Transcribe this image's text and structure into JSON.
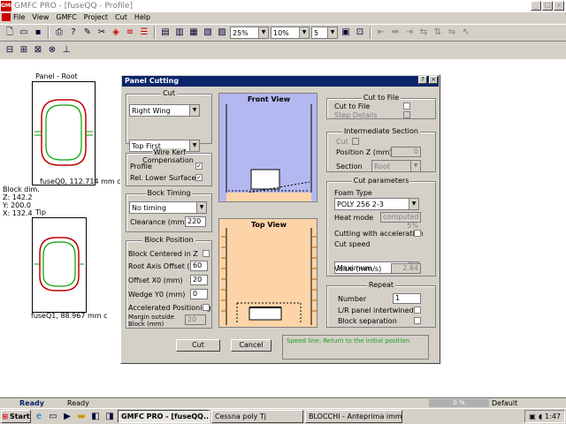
{
  "window": {
    "title": "GMFC PRO - [fuseQQ - Profile]",
    "icon": "gmfc-icon"
  },
  "menu": [
    "File",
    "View",
    "GMFC",
    "Project",
    "Cut",
    "Help"
  ],
  "toolbar": {
    "zoom1": "25%",
    "zoom2": "10%",
    "steps": "5"
  },
  "panels": {
    "root_label": "Panel - Root",
    "root_caption": "fuseQ0, 112.714 mm c",
    "tip_label": "Tip",
    "tip_caption": "fuseQ1, 88.967 mm c",
    "block_dim": [
      "Block dim.",
      "Z: 142.2",
      "Y: 200.0",
      "X: 132.4"
    ]
  },
  "dialog": {
    "title": "Panel Cutting",
    "cut": {
      "title": "Cut",
      "wing": "Right Wing",
      "order": "Top First"
    },
    "kerf": {
      "title": "Wire Kerf Compensation",
      "profile": "Profile",
      "lower": "Rel. Lower Surface"
    },
    "timing": {
      "title": "Bock Timing",
      "mode": "No timing",
      "clearance_label": "Clearance (mm)",
      "clearance": "220"
    },
    "block": {
      "title": "Block Position",
      "centered": "Block Centered in Z",
      "root_axis_label": "Root Axis Offset (mm)",
      "root_axis": "60",
      "offset_x0_label": "Offset X0 (mm)",
      "offset_x0": "20",
      "wedge_label": "Wedge Y0 (mm)",
      "wedge": "0",
      "accel": "Accelerated Positioning",
      "margin_label": "Margin outside Block (mm)",
      "margin": "20"
    },
    "front_view": "Front View",
    "top_view": "Top View",
    "cut_to_file": {
      "title": "Cut to File",
      "cut": "Cut to File",
      "step": "Step Details"
    },
    "intermediate": {
      "title": "Intermediate Section",
      "cut": "Cut",
      "position_label": "Position Z (mm)",
      "position": "0",
      "section_label": "Section",
      "section": "Root"
    },
    "params": {
      "title": "Cut parameters",
      "foam_label": "Foam Type",
      "foam": "POLY 256 2-3",
      "heat_label": "Heat mode",
      "heat": "computed 5%",
      "accel": "Cutting with acceleration",
      "speed_label": "Cut speed",
      "speed": "Maximum",
      "value_label": "Value (mm/s)",
      "value": "2.84"
    },
    "repeat": {
      "title": "Repeat",
      "number_label": "Number",
      "number": "1",
      "lr": "L/R panel intertwined",
      "sep": "Block separation"
    },
    "cut_button": "Cut",
    "cancel_button": "Cancel",
    "status_msg": "Speed line: Return to the initial position"
  },
  "status": {
    "left": "Ready",
    "mid": "Ready",
    "pct": "0 %",
    "right": "Default"
  },
  "taskbar": {
    "start": "Start",
    "tasks": [
      "GMFC PRO - [fuseQQ...",
      "Cessna poly Tj",
      "BLOCCHI - Anteprima imm..."
    ],
    "time": "1:47"
  },
  "colors": {
    "titlebar": "#0a246a",
    "front_bg": "#b4b8f0",
    "top_bg": "#fcd4a8",
    "status_text": "#20a020"
  }
}
